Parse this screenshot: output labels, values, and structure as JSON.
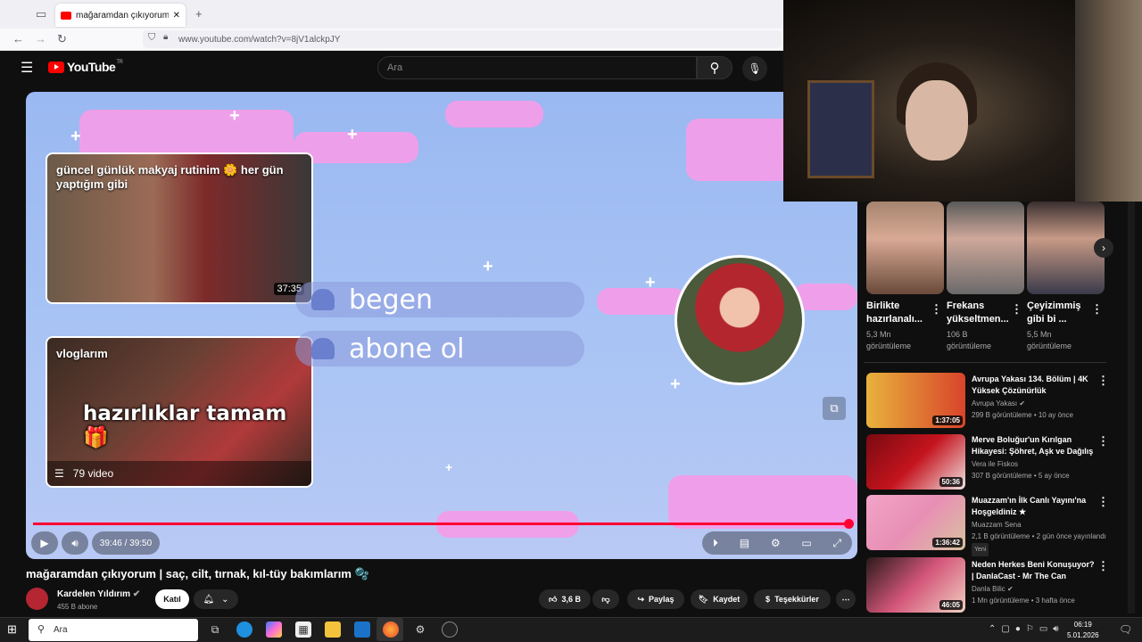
{
  "browser": {
    "tab_title": "mağaramdan çıkıyorum | saç, ci",
    "url": "www.youtube.com/watch?v=8jV1alckpJY",
    "tab_close": "✕",
    "new_tab": "+"
  },
  "youtube": {
    "logo_text": "YouTube",
    "logo_region": "TR",
    "search_placeholder": "Ara"
  },
  "player": {
    "cards": [
      {
        "title": "güncel günlük makyaj rutinim 🌼 her gün yaptığım gibi",
        "duration": "37:35"
      },
      {
        "title": "vloglarım",
        "overlay_text": "hazırlıklar tamam🎁",
        "playlist_count": "79 video"
      }
    ],
    "pills": [
      "begen",
      "abone ol"
    ],
    "time": "39:46 / 39:50",
    "progress_fraction": 0.999
  },
  "video": {
    "title": "mağaramdan çıkıyorum | saç, cilt, tırnak, kıl-tüy bakımlarım 🫧",
    "channel": "Kardelen Yıldırım",
    "subscribers": "455 B abone",
    "join_label": "Katıl",
    "likes": "3,6 B",
    "share_label": "Paylaş",
    "save_label": "Kaydet",
    "thanks_label": "Teşekkürler"
  },
  "shorts": [
    {
      "title": "Birlikte hazırlanalı...",
      "views": "5,3 Mn",
      "views_label": "görüntüleme",
      "color": "#c79a86"
    },
    {
      "title": "Frekans yükseltmen...",
      "views": "106 B",
      "views_label": "görüntüleme",
      "color": "#8a7a6e"
    },
    {
      "title": "Çeyizimmiş gibi bi ...",
      "views": "5,5 Mn",
      "views_label": "görüntüleme",
      "color": "#6a5b55"
    }
  ],
  "recommended": [
    {
      "title": "Avrupa Yakası 134. Bölüm | 4K Yüksek Çözünürlük",
      "channel": "Avrupa Yakası",
      "meta": "299 B görüntüleme • 10 ay önce",
      "duration": "1:37:05",
      "badge": "",
      "color": "#d9442b"
    },
    {
      "title": "Merve Boluğur'un Kırılgan Hikayesi: Şöhret, Aşk ve Dağılış",
      "channel": "Vera ile Fiskos",
      "meta": "307 B görüntüleme • 5 ay önce",
      "duration": "50:36",
      "badge": "",
      "color": "#c4141e"
    },
    {
      "title": "Muazzam'ın İlk Canlı Yayını'na Hoşgeldiniz ★",
      "channel": "Muazzam Sena",
      "meta": "2,1 B görüntüleme • 2 gün önce yayınlandı",
      "duration": "1:36:42",
      "badge": "Yeni",
      "color": "#e88fb4"
    },
    {
      "title": "Neden Herkes Beni Konuşuyor? | DanlaCast - Mr The Can",
      "channel": "Danla Bilic",
      "meta": "1 Mn görüntüleme • 3 hafta önce",
      "duration": "46:05",
      "badge": "",
      "color": "#d4567a"
    }
  ],
  "taskbar": {
    "search_placeholder": "Ara",
    "time": "06:19",
    "date": "5.01.2026"
  }
}
